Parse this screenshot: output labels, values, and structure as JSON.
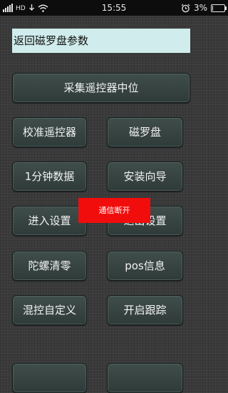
{
  "status_bar": {
    "network_type": "HD",
    "time": "15:55",
    "battery_percent": "3%",
    "battery_level": 0.03,
    "icons": [
      "signal-icon",
      "hd-icon",
      "download-icon",
      "wifi-icon",
      "alarm-icon",
      "battery-icon"
    ]
  },
  "return_field": {
    "label": "返回磁罗盘参数"
  },
  "buttons": {
    "collect_center": "采集遥控器中位",
    "calibrate_remote": "校准遥控器",
    "compass": "磁罗盘",
    "one_min_data": "1分钟数据",
    "install_guide": "安装向导",
    "enter_settings": "进入设置",
    "exit_settings": "退出设置",
    "gyro_zero": "陀螺清零",
    "pos_info": "pos信息",
    "mix_custom": "混控自定义",
    "start_tracking": "开启跟踪"
  },
  "toast": {
    "text": "通信断开"
  },
  "colors": {
    "background": "#3a3a3a",
    "button_bg": "#35433f",
    "return_field_bg": "#d0ecec",
    "toast_bg": "#f20d0d"
  }
}
